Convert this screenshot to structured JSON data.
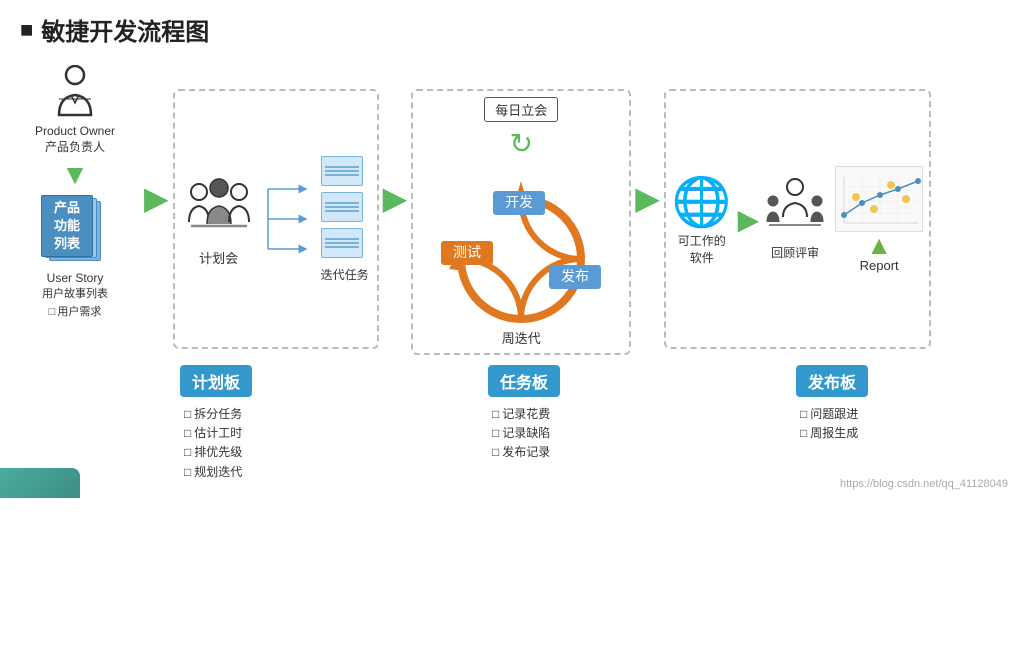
{
  "title": {
    "prefix_square": "■",
    "text": "敏捷开发流程图"
  },
  "left_column": {
    "person_label1": "Product Owner",
    "person_label2": "产品负责人",
    "doc_label1": "产品",
    "doc_label2": "功能",
    "doc_label3": "列表",
    "story_label1": "User Story",
    "story_label2": "用户故事列表",
    "checkbox_user_req": "用户需求"
  },
  "flow_nodes": {
    "plan_meeting": "计划会",
    "iteration_tasks": "迭代任务",
    "cycle_label": "周迭代",
    "daily_standup": "每日立会",
    "develop": "开发",
    "test": "测试",
    "release": "发布",
    "working_software": "可工作的\n软件",
    "review": "回顾评审",
    "report": "Report"
  },
  "boards": {
    "plan_board": {
      "label": "计划板",
      "items": [
        "拆分任务",
        "估计工时",
        "排优先级",
        "规划迭代"
      ]
    },
    "task_board": {
      "label": "任务板",
      "items": [
        "记录花费",
        "记录缺陷",
        "发布记录"
      ]
    },
    "release_board": {
      "label": "发布板",
      "items": [
        "问题跟进",
        "周报生成"
      ]
    }
  },
  "watermark": "https://blog.csdn.net/qq_41128049"
}
